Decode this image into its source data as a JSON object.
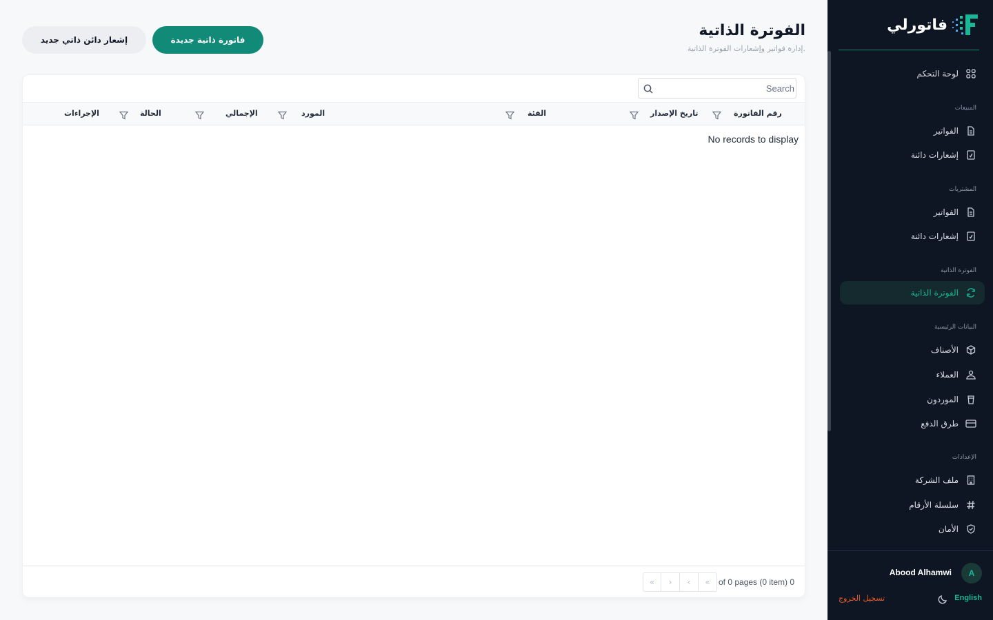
{
  "brand": {
    "name": "فاتورلي",
    "accent": "#18b797"
  },
  "sidebar": {
    "dashboard": {
      "label": "لوحة التحكم",
      "icon": "grid-icon"
    },
    "sections": {
      "sales": "المبيعات",
      "purchases": "المشتريات",
      "self_billing": "الفوترة الذاتية",
      "master_data": "البيانات الرئيسية",
      "settings": "الإعدادات"
    },
    "sales_items": [
      {
        "label": "الفواتير",
        "icon": "file-icon"
      },
      {
        "label": "إشعارات دائنة",
        "icon": "note-icon"
      }
    ],
    "purchase_items": [
      {
        "label": "الفواتير",
        "icon": "file-icon"
      },
      {
        "label": "إشعارات دائنة",
        "icon": "note-icon"
      }
    ],
    "self_billing_items": [
      {
        "label": "الفوترة الذاتية",
        "icon": "refresh-icon",
        "active": true
      }
    ],
    "master_items": [
      {
        "label": "الأصناف",
        "icon": "box-icon"
      },
      {
        "label": "العملاء",
        "icon": "users-icon"
      },
      {
        "label": "الموردون",
        "icon": "cup-icon"
      },
      {
        "label": "طرق الدفع",
        "icon": "card-icon"
      }
    ],
    "settings_items": [
      {
        "label": "ملف الشركة",
        "icon": "building-icon"
      },
      {
        "label": "سلسلة الأرقام",
        "icon": "hash-icon"
      },
      {
        "label": "الأمان",
        "icon": "shield-icon"
      }
    ]
  },
  "user": {
    "name": "Abood Alhamwi",
    "initial": "A"
  },
  "footer": {
    "language": "English",
    "logout": "تسجيل الخروج"
  },
  "page": {
    "title": "الفوترة الذاتية",
    "subtitle": "إدارة فواتير وإشعارات الفوترة الذاتية."
  },
  "actions": {
    "new_invoice": "فاتورة ذاتية جديدة",
    "new_credit_note": "إشعار دائن ذاتي جديد"
  },
  "table": {
    "search_placeholder": "Search",
    "columns": [
      "رقم الفاتورة",
      "تاريخ الإصدار",
      "الفئة",
      "المورد",
      "الإجمالي",
      "الحالة",
      "الإجراءات"
    ],
    "empty_message": "No records to display"
  },
  "pagination": {
    "info": "of 0 pages (0 item) 0"
  }
}
